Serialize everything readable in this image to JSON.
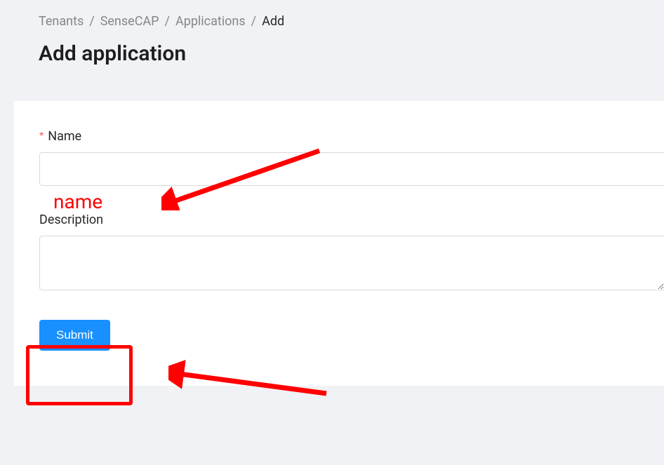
{
  "breadcrumb": {
    "items": [
      "Tenants",
      "SenseCAP",
      "Applications"
    ],
    "current": "Add",
    "separator": "/"
  },
  "page": {
    "title": "Add application"
  },
  "form": {
    "name": {
      "label": "Name",
      "value": "",
      "required": true
    },
    "description": {
      "label": "Description",
      "value": ""
    },
    "submit_label": "Submit"
  },
  "annotations": {
    "name_overlay": "name"
  }
}
